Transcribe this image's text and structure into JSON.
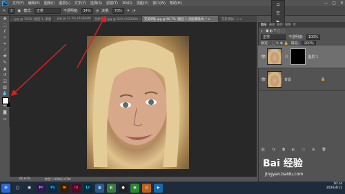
{
  "menubar": {
    "app": "Ps",
    "items": [
      "文件(F)",
      "编辑(E)",
      "图像(I)",
      "图层(L)",
      "文字(Y)",
      "选择(S)",
      "滤镜(T)",
      "3D(D)",
      "视图(V)",
      "窗口(W)",
      "帮助(H)"
    ]
  },
  "window_buttons": [
    "—",
    "▢",
    "✕"
  ],
  "options": {
    "size": "5",
    "mode_label": "模式:",
    "mode": "正常",
    "opacity_label": "不透明度:",
    "opacity": "34%",
    "flow_label": "流量:",
    "flow": "70%"
  },
  "tabs": [
    {
      "label": "...jpg @ 110% (图层 1, 蒙版/8) * ×",
      "active": false
    },
    {
      "label": "...jpg @ 33.3% (RGB/8#) ×",
      "active": false
    },
    {
      "label": "色彩快速.jpg @ 50% (RGB/8#) ×",
      "active": false
    },
    {
      "label": "完美修肤.jpg @ 66.7% (图层 1, 图层蒙版/8) * ×",
      "active": true
    },
    {
      "label": "完美修肤(...) ×",
      "active": false
    }
  ],
  "status": {
    "zoom": "66.67%",
    "doc": "文档:1.09M/2.87M"
  },
  "layers_panel": {
    "tabs": [
      "图层",
      "通道",
      "路径",
      "调整",
      "库"
    ],
    "mode": "正常",
    "opacity_label": "不透明度:",
    "opacity": "100%",
    "fill_label": "填充:",
    "fill": "100%",
    "lock_label": "锁定:",
    "layers": [
      {
        "name": "图层 1",
        "selected": true,
        "has_mask": true
      },
      {
        "name": "背景",
        "selected": false,
        "has_mask": false
      }
    ]
  },
  "taskbar": {
    "apps": [
      {
        "icon": "pr-icon",
        "label": "Pr",
        "color": "#2a1a4a"
      },
      {
        "icon": "ps-icon",
        "label": "Ps",
        "color": "#0b2b44"
      },
      {
        "icon": "ai-icon",
        "label": "Ai",
        "color": "#3a1c00"
      },
      {
        "icon": "id-icon",
        "label": "Id",
        "color": "#4a0c26"
      },
      {
        "icon": "lr-icon",
        "label": "Lr",
        "color": "#0a2a3a"
      },
      {
        "icon": "explorer-icon",
        "label": "▦",
        "color": "#2a5a8a"
      },
      {
        "icon": "store-icon",
        "label": "◐",
        "color": "#3a7a3a"
      },
      {
        "icon": "qq-icon",
        "label": "●",
        "color": "#222"
      },
      {
        "icon": "chrome-icon",
        "label": "◉",
        "color": "#2a8a2a"
      },
      {
        "icon": "browser-icon",
        "label": "◎",
        "color": "#c0601a"
      },
      {
        "icon": "video-icon",
        "label": "▶",
        "color": "#1a6aaa"
      }
    ],
    "time": "10:14",
    "date": "2020/4/11"
  },
  "watermark": {
    "brand": "Bai 经验",
    "url": "jingyan.baidu.com"
  }
}
